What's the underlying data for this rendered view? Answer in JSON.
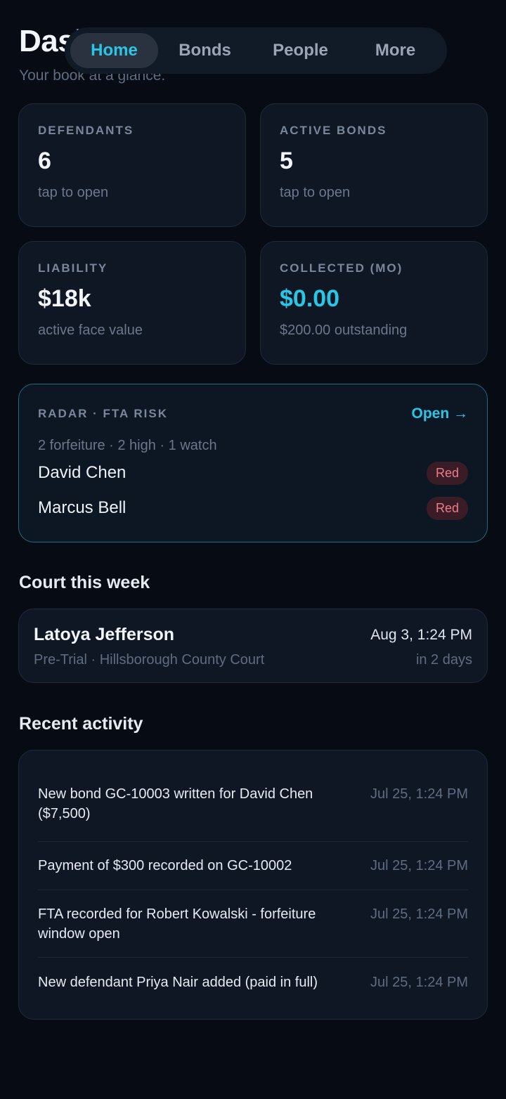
{
  "header": {
    "title": "Dashboard",
    "subtitle": "Your book at a glance."
  },
  "nav": {
    "tabs": [
      {
        "label": "Home",
        "active": true
      },
      {
        "label": "Bonds",
        "active": false
      },
      {
        "label": "People",
        "active": false
      },
      {
        "label": "More",
        "active": false
      }
    ]
  },
  "stats": [
    {
      "label": "DEFENDANTS",
      "value": "6",
      "sub": "tap to open"
    },
    {
      "label": "ACTIVE BONDS",
      "value": "5",
      "sub": "tap to open"
    },
    {
      "label": "LIABILITY",
      "value": "$18k",
      "sub": "active face value"
    },
    {
      "label": "COLLECTED (MO)",
      "value": "$0.00",
      "sub": "$200.00 outstanding"
    }
  ],
  "radar": {
    "label": "RADAR · FTA RISK",
    "open_label": "Open →",
    "summary": "2 forfeiture · 2 high · 1 watch",
    "rows": [
      {
        "name": "David Chen",
        "level": "Red"
      },
      {
        "name": "Marcus Bell",
        "level": "Red"
      }
    ]
  },
  "court": {
    "title": "Court this week",
    "item": {
      "name": "Latoya Jefferson",
      "detail": "Pre-Trial · Hillsborough County Court",
      "date": "Aug 3, 1:24 PM",
      "relative": "in 2 days"
    }
  },
  "activity": {
    "title": "Recent activity",
    "items": [
      {
        "text": "New bond GC-10003 written for David Chen ($7,500)",
        "time": "Jul 25, 1:24 PM"
      },
      {
        "text": "Payment of $300 recorded on GC-10002",
        "time": "Jul 25, 1:24 PM"
      },
      {
        "text": "FTA recorded for Robert Kowalski - forfeiture window open",
        "time": "Jul 25, 1:24 PM"
      },
      {
        "text": "New defendant Priya Nair added (paid in full)",
        "time": "Jul 25, 1:24 PM"
      }
    ]
  },
  "colors": {
    "background": "#070c14",
    "card": "#0f1724",
    "accent": "#29c6e6",
    "risk_red": "#f07a8c"
  }
}
